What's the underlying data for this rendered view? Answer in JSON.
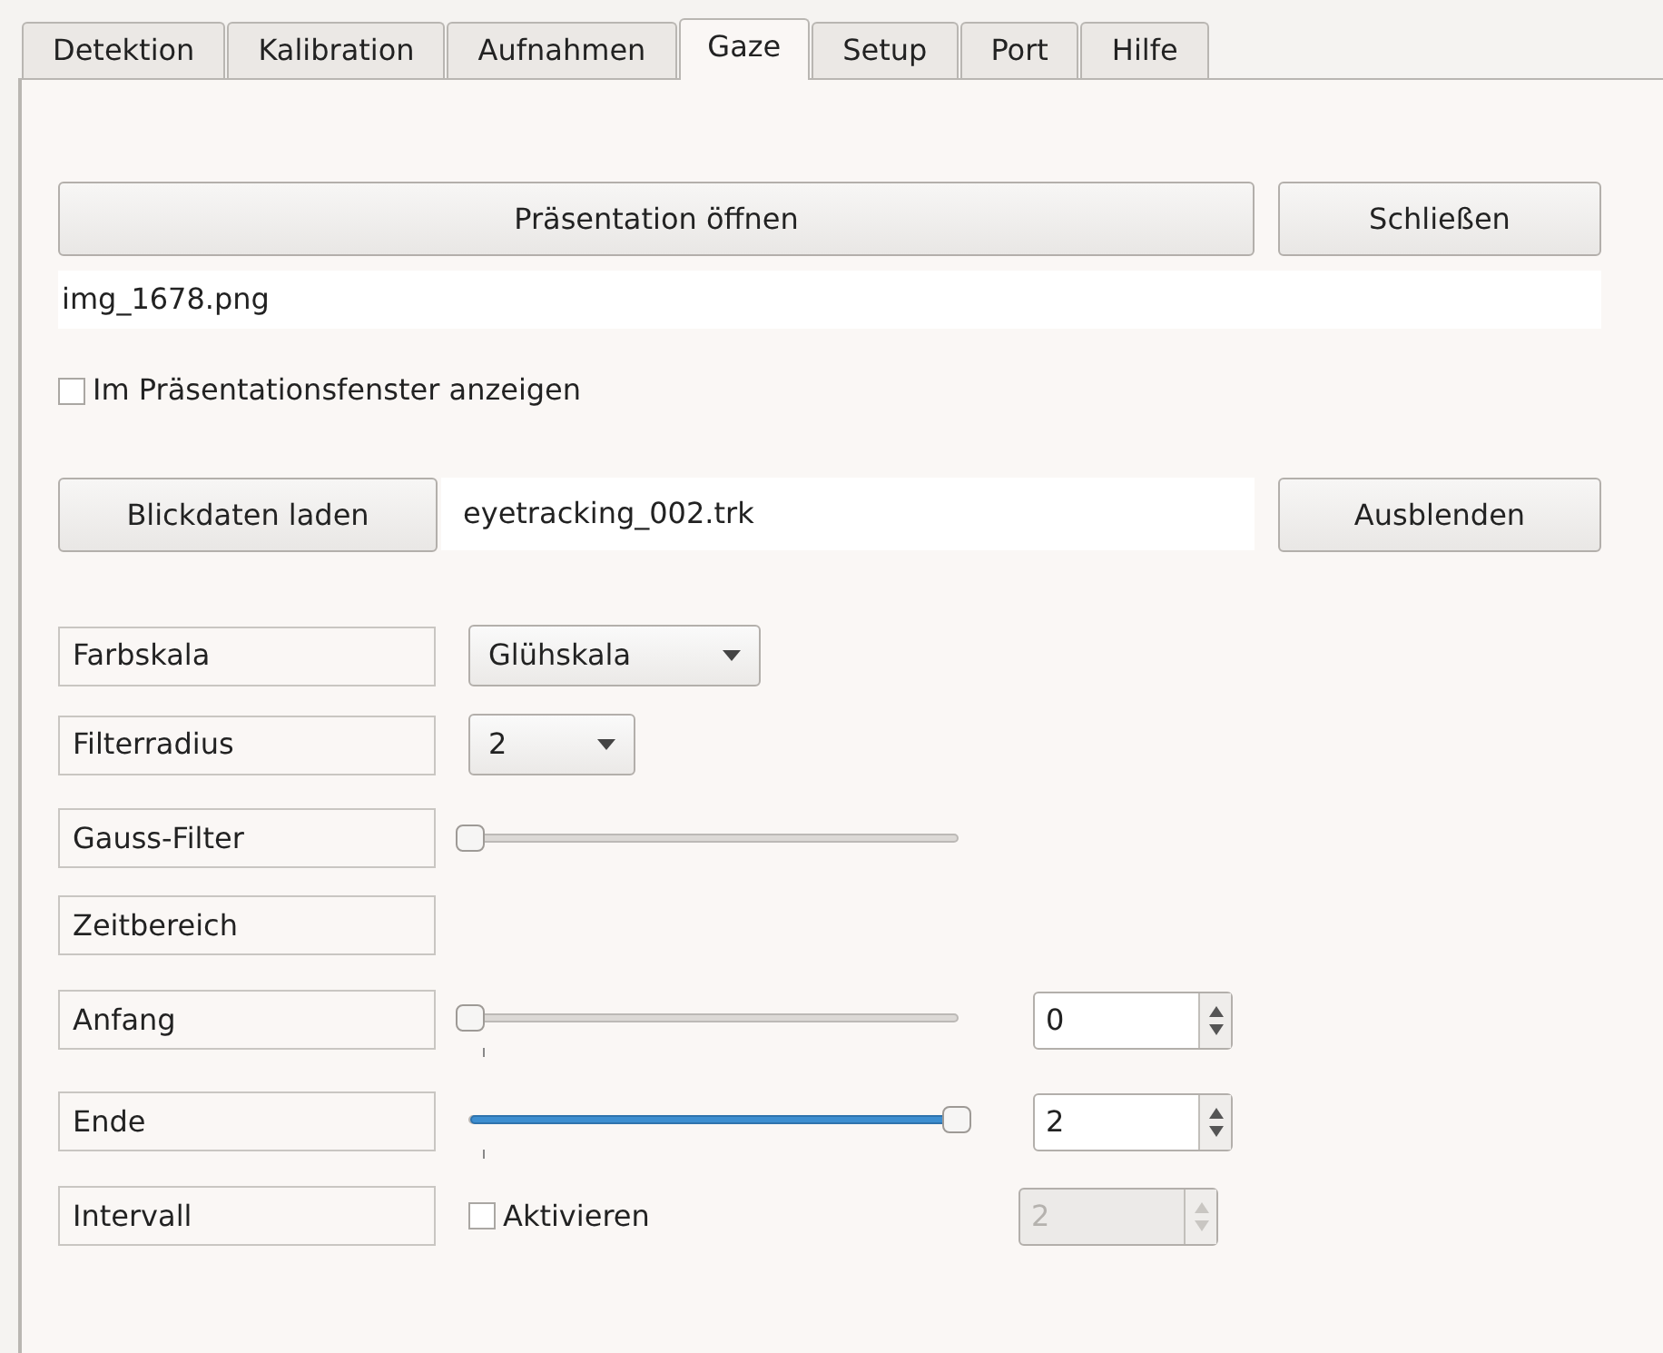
{
  "tabs": [
    {
      "label": "Detektion",
      "selected": false
    },
    {
      "label": "Kalibration",
      "selected": false
    },
    {
      "label": "Aufnahmen",
      "selected": false
    },
    {
      "label": "Gaze",
      "selected": true
    },
    {
      "label": "Setup",
      "selected": false
    },
    {
      "label": "Port",
      "selected": false
    },
    {
      "label": "Hilfe",
      "selected": false
    }
  ],
  "presentation": {
    "open_button": "Präsentation öffnen",
    "close_button": "Schließen",
    "file_name": "img_1678.png",
    "show_in_window": {
      "label": "Im Präsentationsfenster anzeigen",
      "checked": false
    }
  },
  "gaze_data": {
    "load_button": "Blickdaten laden",
    "file_name": "eyetracking_002.trk",
    "hide_button": "Ausblenden"
  },
  "settings": [
    {
      "kind": "combo",
      "label": "Farbskala",
      "value": "Glühskala"
    },
    {
      "kind": "combo",
      "label": "Filterradius",
      "value": "2"
    },
    {
      "kind": "slider",
      "label": "Gauss-Filter",
      "level": 0
    },
    {
      "kind": "heading",
      "label": "Zeitbereich"
    },
    {
      "kind": "slider_spin",
      "label": "Anfang",
      "level": 0,
      "value": "0",
      "disabled": false
    },
    {
      "kind": "slider_spin",
      "label": "Ende",
      "level": 1,
      "value": "2",
      "disabled": false
    },
    {
      "kind": "check_spin",
      "label": "Intervall",
      "check_label": "Aktivieren",
      "checked": false,
      "value": "2",
      "disabled": true
    }
  ]
}
